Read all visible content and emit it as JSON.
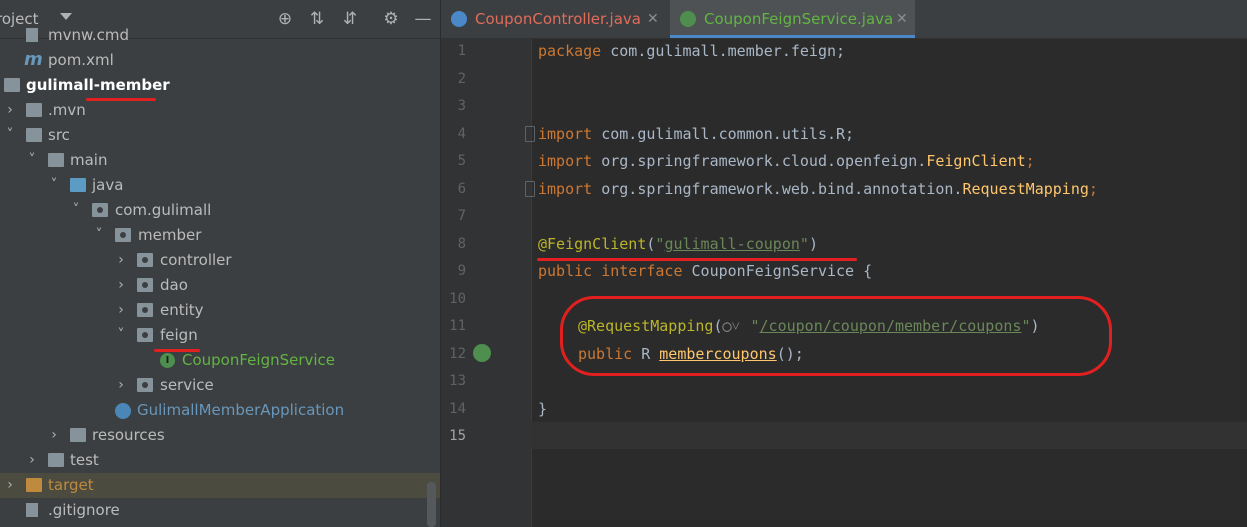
{
  "project_panel": {
    "title": "roject",
    "tree": [
      {
        "label": "mvnw.cmd",
        "color": "#bbbbbb"
      },
      {
        "label": "pom.xml",
        "color": "#bbbbbb"
      },
      {
        "label": "gulimall-member",
        "color": "#ffffff"
      },
      {
        "label": ".mvn",
        "color": "#bbbbbb"
      },
      {
        "label": "src",
        "color": "#bbbbbb"
      },
      {
        "label": "main",
        "color": "#bbbbbb"
      },
      {
        "label": "java",
        "color": "#bbbbbb"
      },
      {
        "label": "com.gulimall",
        "color": "#bbbbbb"
      },
      {
        "label": "member",
        "color": "#bbbbbb"
      },
      {
        "label": "controller",
        "color": "#bbbbbb"
      },
      {
        "label": "dao",
        "color": "#bbbbbb"
      },
      {
        "label": "entity",
        "color": "#bbbbbb"
      },
      {
        "label": "feign",
        "color": "#bbbbbb"
      },
      {
        "label": "CouponFeignService",
        "color": "#62b543"
      },
      {
        "label": "service",
        "color": "#bbbbbb"
      },
      {
        "label": "GulimallMemberApplication",
        "color": "#6897bb"
      },
      {
        "label": "resources",
        "color": "#bbbbbb"
      },
      {
        "label": "test",
        "color": "#bbbbbb"
      },
      {
        "label": "target",
        "color": "#c08a3e"
      },
      {
        "label": ".gitignore",
        "color": "#bbbbbb"
      }
    ]
  },
  "tabs": [
    {
      "label": "CouponController.java",
      "active": false,
      "color": "#e06c5b"
    },
    {
      "label": "CouponFeignService.java",
      "active": true,
      "color": "#62b543"
    }
  ],
  "editor": {
    "line_numbers": [
      "1",
      "2",
      "3",
      "4",
      "5",
      "6",
      "7",
      "8",
      "9",
      "10",
      "11",
      "12",
      "13",
      "14",
      "15"
    ],
    "current_line": "15",
    "code": {
      "l1_kw": "package",
      "l1_rest": " com.gulimall.member.feign;",
      "l4_kw": "import",
      "l4_rest": " com.gulimall.common.utils.R;",
      "l5_kw": "import",
      "l5_rest": " org.springframework.cloud.openfeign.",
      "l5_cls": "FeignClient",
      "l5_end": ";",
      "l6_kw": "import",
      "l6_rest": " org.springframework.web.bind.annotation.",
      "l6_cls": "RequestMapping",
      "l6_end": ";",
      "l8_ann": "@FeignClient",
      "l8_open": "(",
      "l8_q1": "\"",
      "l8_str": "gulimall-coupon",
      "l8_q2": "\"",
      "l8_close": ")",
      "l9_kw": "public interface",
      "l9_rest": " CouponFeignService {",
      "l11_ann": "@RequestMapping",
      "l11_open": "(",
      "l11_q1": "\"",
      "l11_str": "/coupon/coupon/member/coupons",
      "l11_q2": "\"",
      "l11_close": ")",
      "l12_kw": "public",
      "l12_type": " R ",
      "l12_method": "membercoupons",
      "l12_end": "();",
      "l14": "}"
    }
  }
}
